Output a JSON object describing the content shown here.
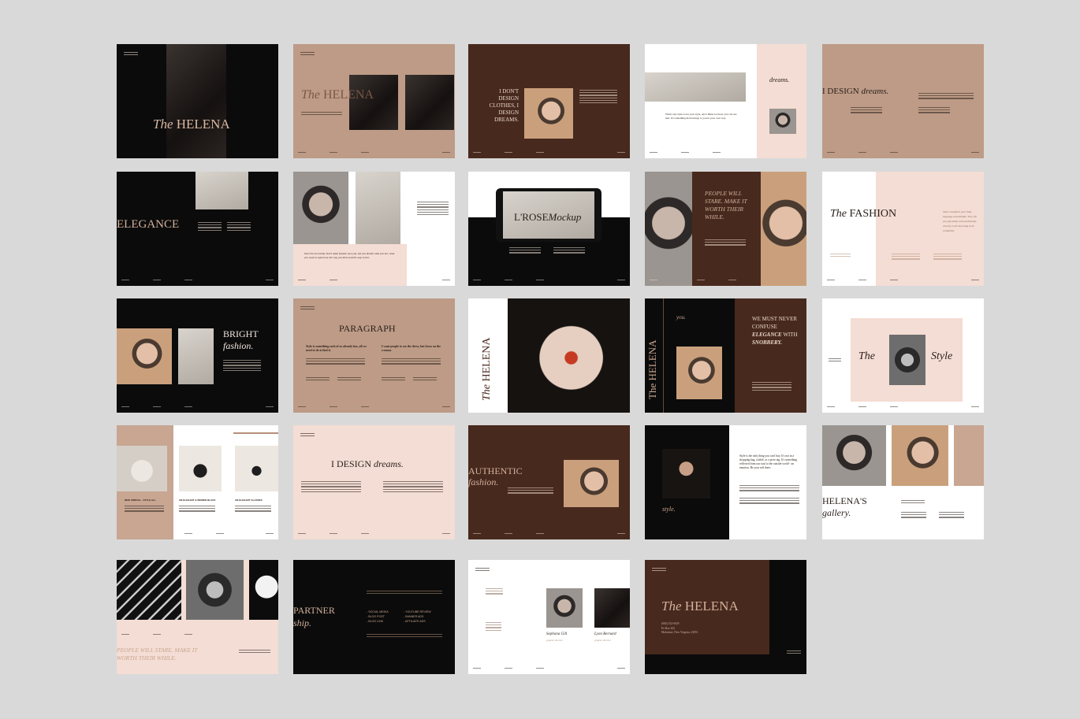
{
  "background_color": "#d9d9d9",
  "slides": {
    "s1": {
      "title_italic": "The",
      "title": "HELENA"
    },
    "s2": {
      "title_italic": "The",
      "title": "HELENA"
    },
    "s3": {
      "heading": "I DON'T DESIGN CLOTHES, I DESIGN DREAMS."
    },
    "s4": {
      "heading_italic": "dreams.",
      "quote": "What's my style is not your style, and I think we know you can see that. It's something that belongs to you in your own way."
    },
    "s5": {
      "heading": "I DESIGN",
      "heading_italic": "dreams."
    },
    "s6": {
      "heading": "ELEGANCE"
    },
    "s7": {
      "quote": "Don't be too trendy. Don't make fashion own you, but you decide what you are, what you want to express by the way you dress and the way to live."
    },
    "s8": {
      "heading": "L'ROSE",
      "heading_italic": "Mockup"
    },
    "s9": {
      "quote": "PEOPLE WILL STARE. MAKE IT WORTH THEIR WHILE."
    },
    "s10": {
      "title_italic": "The",
      "title": "FASHION",
      "side_text": "Shoes transform your body language and attitude. They lift you physically and emotionally. Jewelry is the last thing to be completed."
    },
    "s11": {
      "heading": "BRIGHT",
      "heading_italic": "fashion."
    },
    "s12": {
      "heading": "PARAGRAPH",
      "col1": "Style is something each of us already has, all we need to do is find it.",
      "col2": "I want people to see the dress, but focus on the woman."
    },
    "s13": {
      "title_italic": "The",
      "title": "HELENA"
    },
    "s14": {
      "vertical_title": "The HELENA",
      "label_italic": "you.",
      "quote": "WE MUST NEVER CONFUSE",
      "quote_italic": "ELEGANCE",
      "quote2": "WITH",
      "quote_italic2": "SNOBBERY."
    },
    "s15": {
      "left": "The",
      "right": "Style"
    },
    "s16": {
      "labels": [
        "NEW ARRIVAL - STYLE ALL",
        "AN ELEGANT & WOMEN BLACK",
        "AN ELEGANT GLASSES"
      ]
    },
    "s17": {
      "heading": "I DESIGN",
      "heading_italic": "dreams."
    },
    "s18": {
      "heading": "AUTHENTIC",
      "heading_italic": "fashion."
    },
    "s19": {
      "quote": "Style is the only thing you can't buy. It's not in a shopping bag, a label, or a price tag. It's something reflected from our soul to the outside world - an emotion. Be your self there.",
      "label_italic": "style."
    },
    "s20": {
      "heading": "HELENA'S",
      "heading_italic": "gallery."
    },
    "s21": {
      "quote": "PEOPLE WILL STARE. MAKE IT WORTH THEIR WHILE."
    },
    "s22": {
      "heading": "PARTNER",
      "heading_italic": "ship.",
      "list_left": [
        "- SOCIAL MEDIA",
        "- BLOG POST",
        "- BLOG LINK"
      ],
      "list_right": [
        "- YOUTUBE REVIEW",
        "- BANNER ADS",
        "- AFFILIATE ADS"
      ]
    },
    "s23": {
      "names": [
        {
          "name": "Sephona Gill",
          "role": "graphic director"
        },
        {
          "name": "Lyon Bernard",
          "role": "graphic director"
        }
      ]
    },
    "s24": {
      "title_italic": "The",
      "title": "HELENA",
      "phone": "(084) 332-0029",
      "address1": "Po Box 432",
      "address2": "Malvaime, New Virginia, 23851"
    }
  }
}
